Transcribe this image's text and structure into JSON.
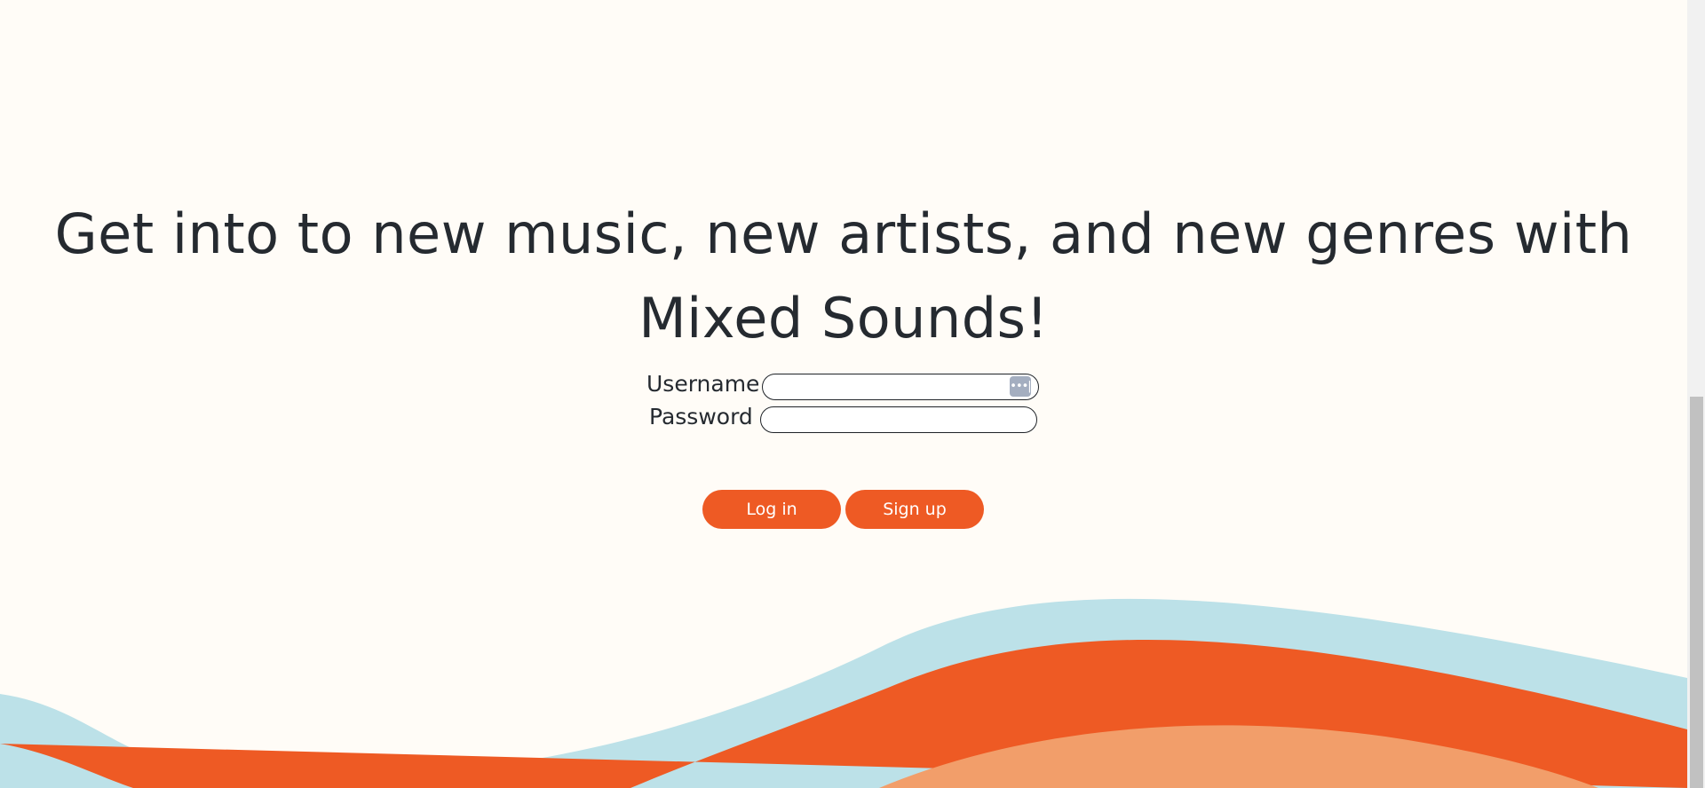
{
  "hero": {
    "headline": "Get into to new music, new artists, and new genres with Mixed Sounds!"
  },
  "login_form": {
    "username_label": "Username",
    "username_value": "",
    "password_label": "Password",
    "password_value": "",
    "password_manager_icon": "key-dots-icon",
    "password_manager_glyph": "•••|"
  },
  "buttons": {
    "login_label": "Log in",
    "signup_label": "Sign up"
  },
  "colors": {
    "background": "#fffcf7",
    "accent": "#ee5a24",
    "wave_blue": "#bce1e8",
    "wave_orange": "#ee5a24",
    "wave_light_orange": "#f29e6a",
    "text": "#252a30"
  }
}
